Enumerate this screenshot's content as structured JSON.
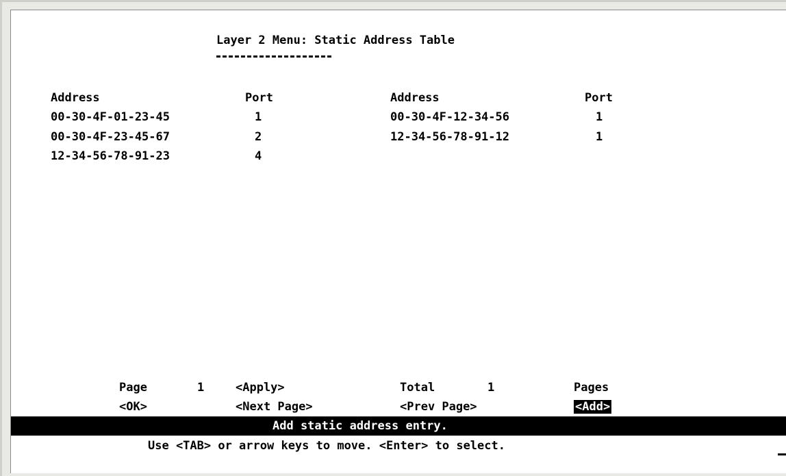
{
  "title": "Layer 2 Menu: Static Address Table",
  "table": {
    "headers": [
      "Address",
      "Port",
      "Address",
      "Port"
    ],
    "left_rows": [
      {
        "address": "00-30-4F-01-23-45",
        "port": "1"
      },
      {
        "address": "00-30-4F-23-45-67",
        "port": "2"
      },
      {
        "address": "12-34-56-78-91-23",
        "port": "4"
      }
    ],
    "right_rows": [
      {
        "address": "00-30-4F-12-34-56",
        "port": "1"
      },
      {
        "address": "12-34-56-78-91-12",
        "port": "1"
      }
    ]
  },
  "footer": {
    "page_label": "Page",
    "page_value": "1",
    "apply": "<Apply>",
    "total_label": "Total",
    "total_value": "1",
    "pages_label": "Pages",
    "ok": "<OK>",
    "next_page": "<Next Page>",
    "prev_page": "<Prev Page>",
    "add": "<Add>"
  },
  "status": {
    "message": "Add static address entry.",
    "help": "Use <TAB> or arrow keys to move. <Enter> to select."
  }
}
